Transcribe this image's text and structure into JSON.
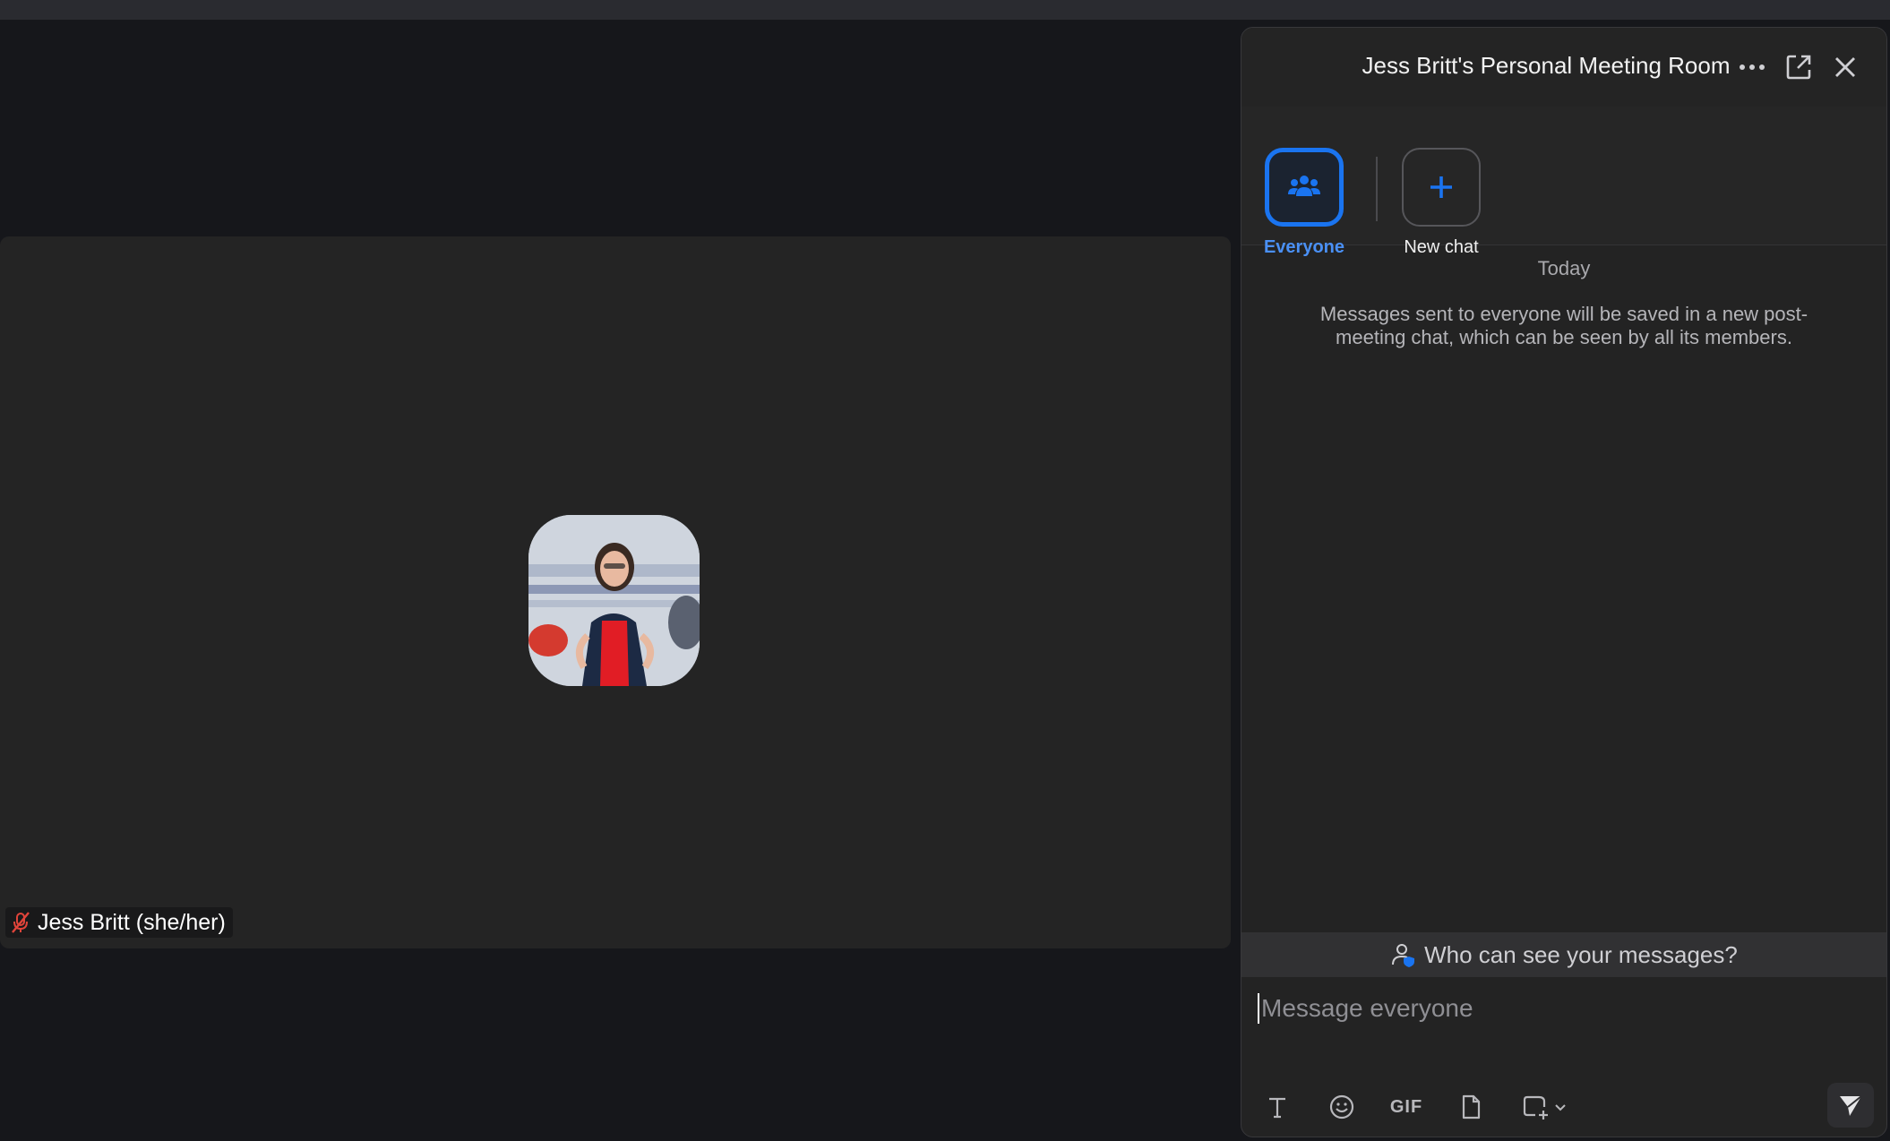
{
  "chat": {
    "title": "Jess Britt's Personal Meeting Room",
    "recipients": [
      {
        "label": "Everyone",
        "icon": "group-icon",
        "active": true
      },
      {
        "label": "New chat",
        "icon": "plus-icon",
        "active": false
      }
    ],
    "day_label": "Today",
    "info_message": "Messages sent to everyone will be saved in a new post-meeting chat, which can be seen by all its members.",
    "privacy_link": "Who can see your messages?",
    "input_placeholder": "Message everyone",
    "toolbar": {
      "gif_label": "GIF"
    }
  },
  "video": {
    "participant_name": "Jess Britt (she/her)",
    "muted": true
  },
  "colors": {
    "accent": "#1a74f0",
    "background": "#16171b",
    "panel": "#232323",
    "muted_red": "#e0443a"
  }
}
